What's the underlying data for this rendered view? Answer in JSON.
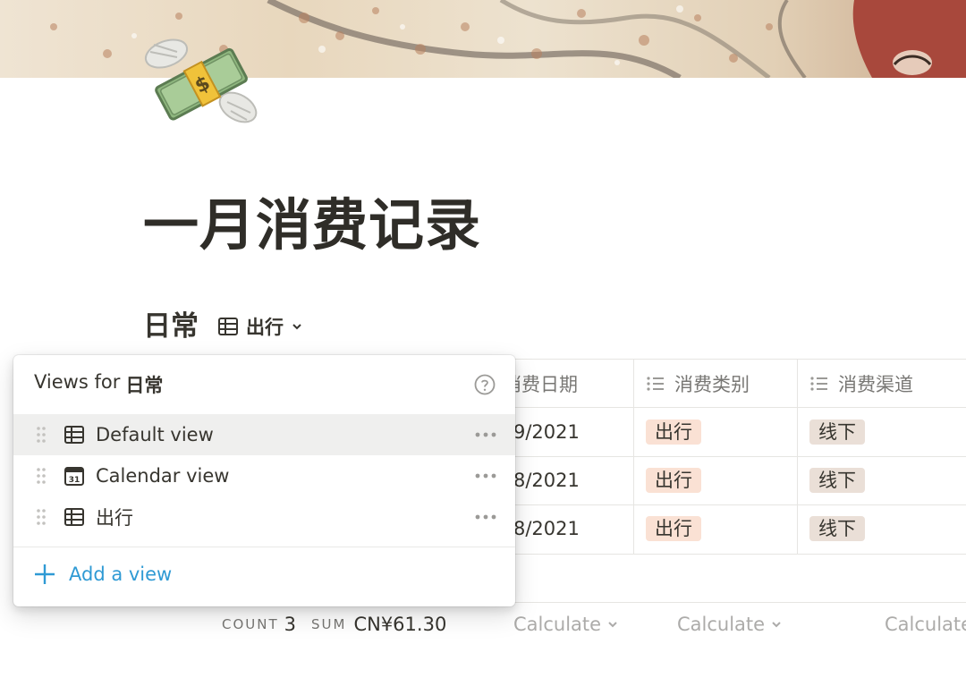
{
  "page": {
    "title": "一月消费记录"
  },
  "database": {
    "title": "日常",
    "current_view": "出行",
    "columns": [
      {
        "label": "消费日期",
        "icon": "calendar-icon"
      },
      {
        "label": "消费类别",
        "icon": "list-icon"
      },
      {
        "label": "消费渠道",
        "icon": "list-icon"
      }
    ],
    "rows": [
      {
        "date": "9/2021",
        "category": "出行",
        "channel": "线下"
      },
      {
        "date": "8/2021",
        "category": "出行",
        "channel": "线下"
      },
      {
        "date": "8/2021",
        "category": "出行",
        "channel": "线下"
      }
    ],
    "footer": {
      "count_label": "COUNT",
      "count_value": "3",
      "sum_label": "SUM",
      "sum_value": "CN¥61.30",
      "calculate_label": "Calculate"
    }
  },
  "views_popover": {
    "heading_prefix": "Views for",
    "heading_db": "日常",
    "views": [
      {
        "label": "Default view",
        "icon": "table-icon",
        "active": true
      },
      {
        "label": "Calendar view",
        "icon": "calendar-icon",
        "active": false
      },
      {
        "label": "出行",
        "icon": "table-icon",
        "active": false
      }
    ],
    "add_label": "Add a view"
  },
  "colors": {
    "tag_orange": "#fae1d4",
    "tag_brown": "#eadfd7",
    "accent_blue": "#2f9ad4",
    "hover_row": "#efefee"
  }
}
